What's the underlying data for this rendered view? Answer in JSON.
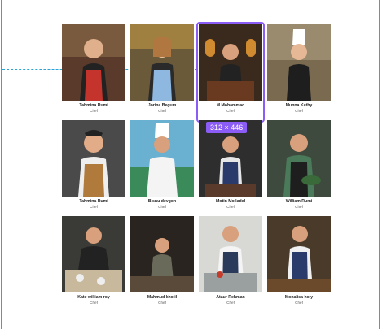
{
  "selection": {
    "size_label": "312 × 446",
    "accent": "#8b5cf6"
  },
  "cards": [
    {
      "name": "Tahmina Rumi",
      "role": "Chef",
      "icon": "chef-photo"
    },
    {
      "name": "Jorina Begum",
      "role": "Chef",
      "icon": "chef-photo"
    },
    {
      "name": "M.Mohammad",
      "role": "Chef",
      "icon": "chef-photo",
      "selected": true
    },
    {
      "name": "Munna Kathy",
      "role": "Chef",
      "icon": "chef-photo"
    },
    {
      "name": "Tahmina Rumi",
      "role": "Chef",
      "icon": "chef-photo"
    },
    {
      "name": "Bisnu devgon",
      "role": "Chef",
      "icon": "chef-photo"
    },
    {
      "name": "Motin Molladel",
      "role": "Chef",
      "icon": "chef-photo"
    },
    {
      "name": "William Rumi",
      "role": "Chef",
      "icon": "chef-photo"
    },
    {
      "name": "Kate william roy",
      "role": "Chef",
      "icon": "chef-photo"
    },
    {
      "name": "Mahmud kholil",
      "role": "Chef",
      "icon": "chef-photo"
    },
    {
      "name": "Ataur Rehman",
      "role": "Chef",
      "icon": "chef-photo"
    },
    {
      "name": "Monalisa holy",
      "role": "Chef",
      "icon": "chef-photo"
    }
  ]
}
